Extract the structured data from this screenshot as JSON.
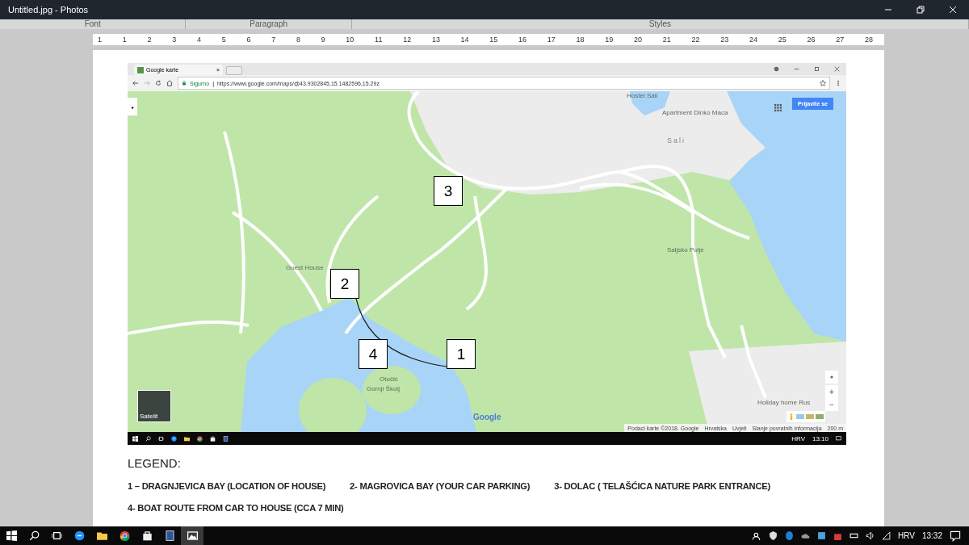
{
  "window": {
    "title": "Untitled.jpg - Photos"
  },
  "ribbon_groups": [
    "Font",
    "Paragraph",
    "Styles"
  ],
  "ruler": [
    "1",
    "1",
    "2",
    "3",
    "4",
    "5",
    "6",
    "7",
    "8",
    "9",
    "10",
    "11",
    "12",
    "13",
    "14",
    "15",
    "16",
    "17",
    "18",
    "19",
    "20",
    "21",
    "22",
    "23",
    "24",
    "25",
    "26",
    "27",
    "28"
  ],
  "browser": {
    "tab": "Google karte",
    "tab_close": "×",
    "separator": "|",
    "security": "Sigurno",
    "url": "https://www.google.com/maps/@43.9302845,15.1482596,15.29z"
  },
  "map": {
    "expand": "▸",
    "sign_in": "Prijavite se",
    "labels": [
      "Hostel Sali",
      "Apartment Dinko Maca",
      "Sali",
      "Saljsko Polje",
      "Guest House",
      "Otočić",
      "Gornji Školj",
      "Holiday home Rus"
    ],
    "markers": [
      "3",
      "2",
      "4",
      "1"
    ],
    "satellite": "Satelit",
    "logo": "Google",
    "zoom_in": "+",
    "zoom_out": "−",
    "attribution": [
      "Podaci karte ©2018. Google",
      "Hrvatska",
      "Uvjeti",
      "Slanje povratnih informacija",
      "200 m"
    ]
  },
  "inner_taskbar": {
    "language": "HRV",
    "time": "13:10"
  },
  "legend": {
    "title": "LEGEND:",
    "items": [
      "1 – DRAGNJEVICA BAY (LOCATION OF HOUSE)",
      "2- MAGROVICA BAY (YOUR CAR PARKING)",
      "3- DOLAC ( TELAŠĆICA NATURE PARK ENTRANCE)",
      "4- BOAT ROUTE FROM CAR TO HOUSE (CCA  7 MIN)"
    ]
  },
  "taskbar": {
    "language": "HRV",
    "time": "13:32"
  }
}
